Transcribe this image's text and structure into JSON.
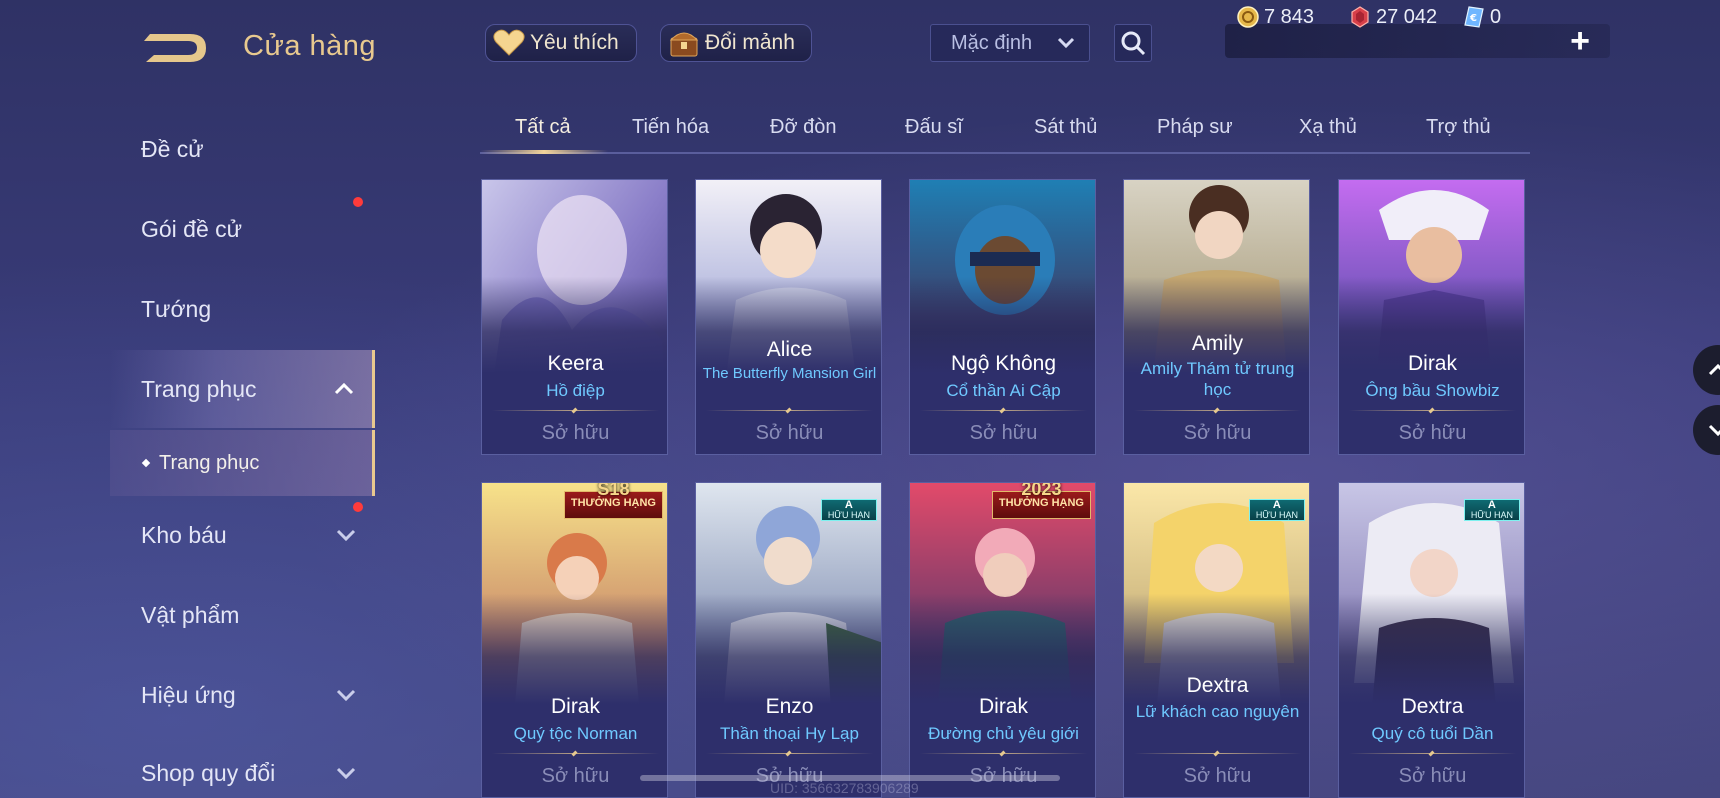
{
  "header": {
    "title": "Cửa hàng",
    "favorite_label": "Yêu thích",
    "exchange_label": "Đổi mảnh",
    "sort_value": "Mặc định"
  },
  "currencies": {
    "gold": "7 843",
    "gems": "27 042",
    "vouchers": "0"
  },
  "sidebar": {
    "items": [
      {
        "label": "Đề cử"
      },
      {
        "label": "Gói đề cử"
      },
      {
        "label": "Tướng"
      },
      {
        "label": "Trang phục"
      },
      {
        "label": "Kho báu"
      },
      {
        "label": "Vật phẩm"
      },
      {
        "label": "Hiệu ứng"
      },
      {
        "label": "Shop quy đổi"
      }
    ],
    "sub_item": "Trang phục"
  },
  "tabs": [
    "Tất cả",
    "Tiến hóa",
    "Đỡ đòn",
    "Đấu sĩ",
    "Sát thủ",
    "Pháp sư",
    "Xạ thủ",
    "Trợ thủ"
  ],
  "cards": [
    {
      "hero": "Keera",
      "skin": "Hồ điệp",
      "status": "Sở hữu",
      "badge_top": "",
      "badge_bottom": ""
    },
    {
      "hero": "Alice",
      "skin": "The Butterfly Mansion Girl",
      "status": "Sở hữu",
      "badge_top": "",
      "badge_bottom": ""
    },
    {
      "hero": "Ngộ Không",
      "skin": "Cổ thần Ai Cập",
      "status": "Sở hữu",
      "badge_top": "",
      "badge_bottom": ""
    },
    {
      "hero": "Amily",
      "skin": "Amily Thám tử trung học",
      "status": "Sở hữu",
      "badge_top": "",
      "badge_bottom": ""
    },
    {
      "hero": "Dirak",
      "skin": "Ông bầu Showbiz",
      "status": "Sở hữu",
      "badge_top": "",
      "badge_bottom": ""
    },
    {
      "hero": "Dirak",
      "skin": "Quý tộc Norman",
      "status": "Sở hữu",
      "badge_top": "S18",
      "badge_bottom": "THƯỞNG HẠNG"
    },
    {
      "hero": "Enzo",
      "skin": "Thần thoại Hy Lạp",
      "status": "Sở hữu",
      "badge_top": "A",
      "badge_bottom": "HỮU HẠN"
    },
    {
      "hero": "Dirak",
      "skin": "Đường chủ yêu giới",
      "status": "Sở hữu",
      "badge_top": "2023",
      "badge_bottom": "THƯỞNG HẠNG"
    },
    {
      "hero": "Dextra",
      "skin": "Lữ khách cao nguyên",
      "status": "Sở hữu",
      "badge_top": "A",
      "badge_bottom": "HỮU HẠN"
    },
    {
      "hero": "Dextra",
      "skin": "Quý cô tuổi Dần",
      "status": "Sở hữu",
      "badge_top": "A",
      "badge_bottom": "HỮU HẠN"
    }
  ],
  "footer": {
    "uid": "UID: 356632783906289"
  },
  "colors": {
    "accent_gold": "#e8c98f",
    "skin_name_blue": "#6fc9ff",
    "notification_red": "#ff3b3b"
  },
  "icons": {
    "back": "back-arrow-icon",
    "favorite": "heart-icon",
    "exchange": "chest-icon",
    "search": "search-icon",
    "gold": "gold-coin-icon",
    "gem": "ruby-icon",
    "voucher": "voucher-icon",
    "add": "plus-icon"
  }
}
